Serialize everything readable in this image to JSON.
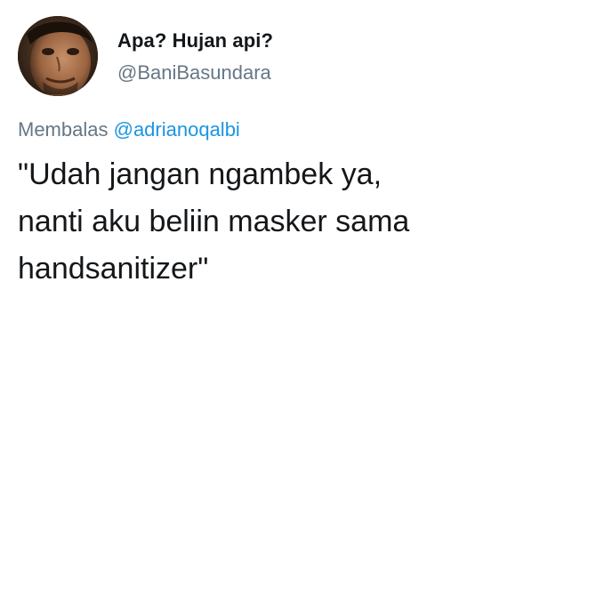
{
  "tweet": {
    "display_name": "Apa? Hujan api?",
    "handle": "@BaniBasundara",
    "reply_prefix": "Membalas",
    "reply_mention": "@adrianoqalbi",
    "text": "\"Udah jangan ngambek ya,\nnanti aku beliin masker sama\nhandsanitizer\""
  },
  "colors": {
    "name": "#14171a",
    "secondary": "#657786",
    "mention": "#1b95e0",
    "background": "#ffffff"
  },
  "icons": {
    "avatar": "profile-photo"
  }
}
